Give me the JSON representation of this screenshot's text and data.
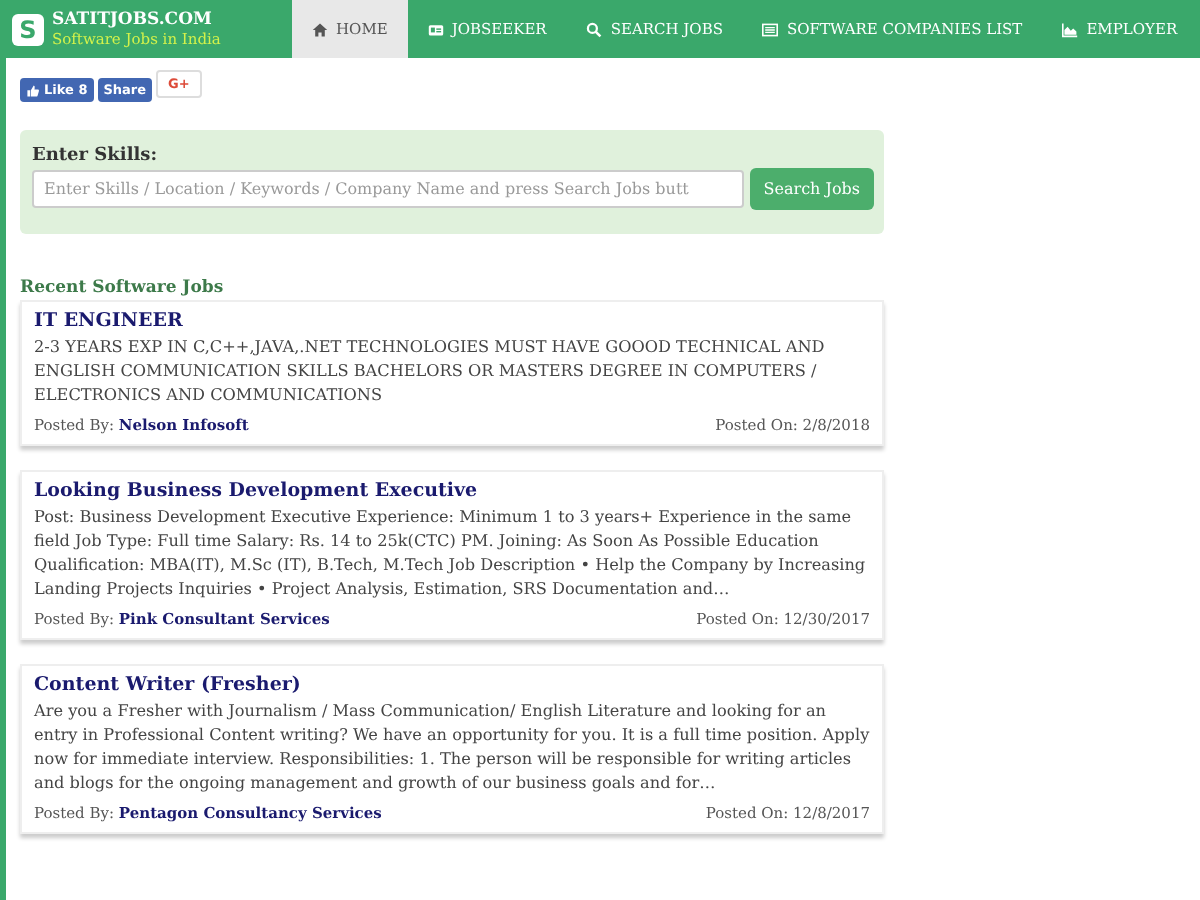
{
  "brand": {
    "logo_letter": "S",
    "name": "SATITJOBS.COM",
    "tagline": "Software Jobs in India"
  },
  "nav": [
    {
      "label": "HOME",
      "selected": true
    },
    {
      "label": "JOBSEEKER",
      "selected": false
    },
    {
      "label": "SEARCH JOBS",
      "selected": false
    },
    {
      "label": "SOFTWARE COMPANIES LIST",
      "selected": false
    },
    {
      "label": "EMPLOYER",
      "selected": false
    }
  ],
  "social": {
    "like": "Like",
    "like_count": "8",
    "share": "Share",
    "gplus": "G+"
  },
  "search": {
    "label": "Enter Skills:",
    "placeholder": "Enter Skills / Location / Keywords / Company Name and press Search Jobs butt",
    "button": "Search Jobs"
  },
  "section_title": "Recent Software Jobs",
  "jobs": [
    {
      "title": "IT ENGINEER",
      "description": "2-3 YEARS EXP IN C,C++,JAVA,.NET TECHNOLOGIES MUST HAVE GOOOD TECHNICAL AND ENGLISH COMMUNICATION SKILLS BACHELORS OR MASTERS DEGREE IN COMPUTERS / ELECTRONICS AND COMMUNICATIONS",
      "posted_by_label": "Posted By:",
      "company": "Nelson Infosoft",
      "posted_on": "Posted On: 2/8/2018"
    },
    {
      "title": "Looking Business Development Executive",
      "description": "Post: Business Development Executive Experience: Minimum 1 to 3 years+ Experience in the same field Job Type: Full time Salary: Rs. 14 to 25k(CTC) PM. Joining: As Soon As Possible Education Qualification: MBA(IT), M.Sc (IT), B.Tech, M.Tech Job Description • Help the Company by Increasing Landing Projects Inquiries • Project Analysis, Estimation, SRS Documentation and…",
      "posted_by_label": "Posted By:",
      "company": "Pink Consultant Services",
      "posted_on": "Posted On: 12/30/2017"
    },
    {
      "title": "Content Writer (Fresher)",
      "description": "Are you a Fresher with Journalism / Mass Communication/ English Literature and looking for an entry in Professional Content writing? We have an opportunity for you. It is a full time position. Apply now for immediate interview. Responsibilities: 1. The person will be responsible for writing articles and blogs for the ongoing management and growth of our business goals and for…",
      "posted_by_label": "Posted By:",
      "company": "Pentagon Consultancy Services",
      "posted_on": "Posted On: 12/8/2017"
    }
  ]
}
